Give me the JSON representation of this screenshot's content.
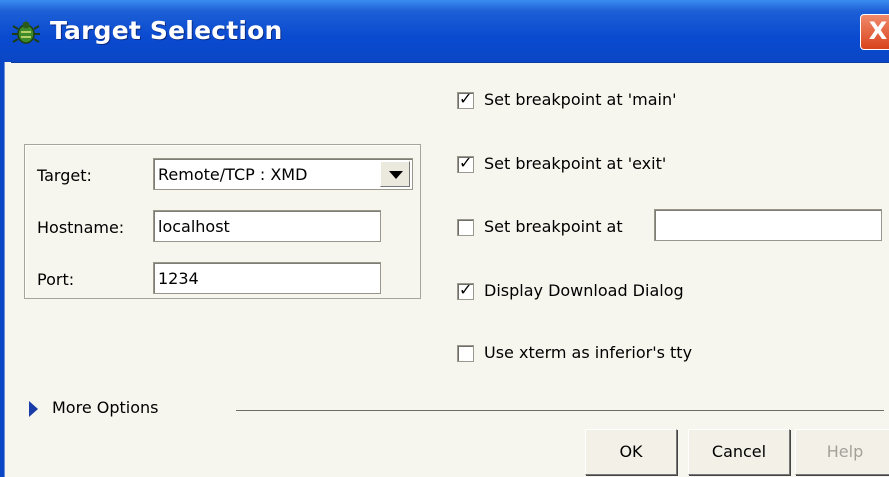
{
  "window": {
    "title": "Target Selection",
    "close_glyph": "X"
  },
  "connection": {
    "target_label": "Target:",
    "target_value": "Remote/TCP : XMD",
    "hostname_label": "Hostname:",
    "hostname_value": "localhost",
    "port_label": "Port:",
    "port_value": "1234"
  },
  "options": [
    {
      "label": "Set breakpoint at 'main'",
      "checked": true
    },
    {
      "label": "Set breakpoint at 'exit'",
      "checked": true
    },
    {
      "label": "Set breakpoint at",
      "checked": false,
      "input_value": ""
    },
    {
      "label": "Display Download Dialog",
      "checked": true
    },
    {
      "label": "Use xterm as inferior's tty",
      "checked": false
    }
  ],
  "more_options": {
    "label": "More Options"
  },
  "buttons": {
    "ok": "OK",
    "cancel": "Cancel",
    "help": "Help",
    "help_enabled": false
  },
  "colors": {
    "titlebar": "#0a47c6",
    "background": "#f7f6ee",
    "close": "#d9431c"
  }
}
